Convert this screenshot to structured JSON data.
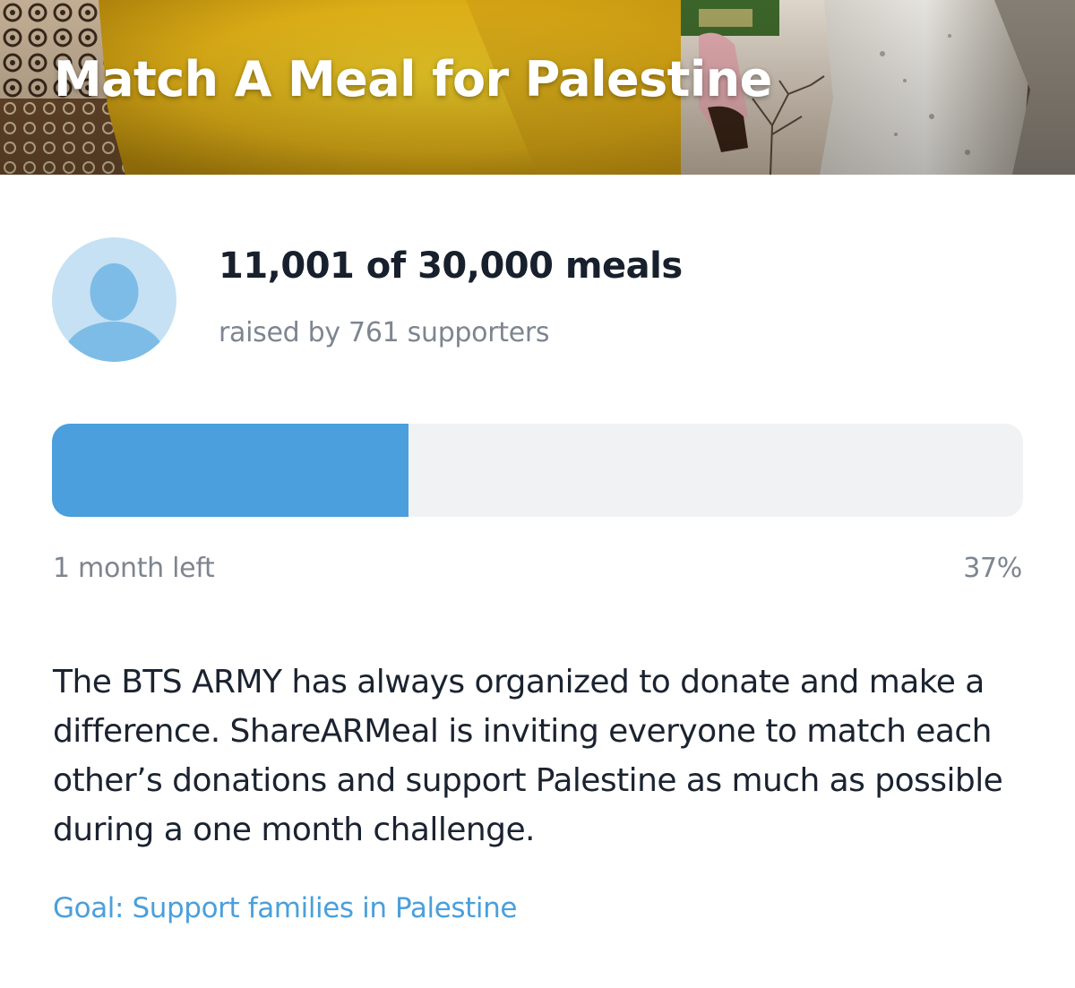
{
  "campaign": {
    "title": "Match A Meal for Palestine"
  },
  "stats": {
    "meals_text": "11,001 of 30,000 meals",
    "supporters_text": "raised by 761 supporters"
  },
  "progress": {
    "fraction": 0.367,
    "time_left": "1 month left",
    "percent_label": "37%",
    "fill_color": "#4a9fdc",
    "track_color": "#f1f2f4"
  },
  "description": "The BTS ARMY has always organized to donate and make a difference. ShareARMeal is inviting everyone to match each other’s donations and support Palestine as much as possible during a one month challenge.",
  "goal": {
    "text": "Goal: Support families in Palestine",
    "color": "#4a9fdc"
  },
  "avatar": {
    "icon": "user-placeholder-icon",
    "background": "#c6e1f3",
    "figure_color": "#7dbce6"
  }
}
